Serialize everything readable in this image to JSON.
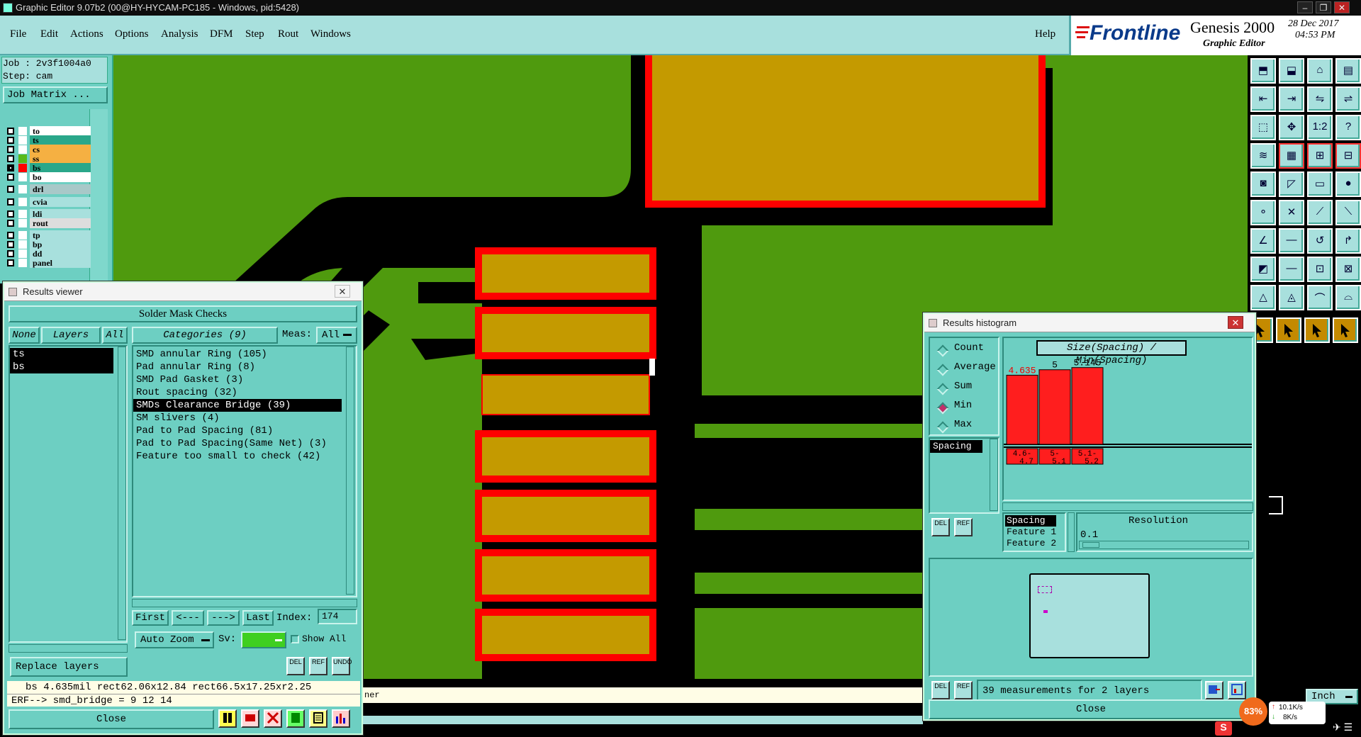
{
  "window": {
    "title": "Graphic Editor 9.07b2 (00@HY-HYCAM-PC185 - Windows, pid:5428)"
  },
  "menu": [
    "File",
    "Edit",
    "Actions",
    "Options",
    "Analysis",
    "DFM",
    "Step",
    "Rout",
    "Windows"
  ],
  "help_label": "Help",
  "brand": {
    "logo": "Frontline",
    "product": "Genesis 2000",
    "subtitle": "Graphic Editor",
    "date": "28 Dec 2017",
    "time": "04:53 PM"
  },
  "job": {
    "job_line": "Job : 2v3f1004a0",
    "step_line": "Step: cam",
    "matrix_button": "Job Matrix ..."
  },
  "layers": [
    {
      "name": "to",
      "color": "#ffffff",
      "swatch": "#ffffff",
      "checked": false
    },
    {
      "name": "ts",
      "color": "#2aa78a",
      "swatch": "#ffffff",
      "checked": false
    },
    {
      "name": "cs",
      "color": "#f5b042",
      "swatch": "#ffffff",
      "checked": false
    },
    {
      "name": "ss",
      "color": "#f5b042",
      "swatch": "#58b91a",
      "checked": false
    },
    {
      "name": "bs",
      "color": "#2aa78a",
      "swatch": "#ff0000",
      "checked": true
    },
    {
      "name": "bo",
      "color": "#ffffff",
      "swatch": "#ffffff",
      "checked": false
    },
    {
      "name": "drl",
      "color": "#a8c8c8",
      "swatch": "#ffffff",
      "checked": false
    },
    {
      "name": "cvia",
      "color": "#a8e0dd",
      "swatch": "#ffffff",
      "checked": false
    },
    {
      "name": "ldi",
      "color": "#a8e0dd",
      "swatch": "#ffffff",
      "checked": false
    },
    {
      "name": "rout",
      "color": "#dddddd",
      "swatch": "#ffffff",
      "checked": false
    },
    {
      "name": "tp",
      "color": "#a8e0dd",
      "swatch": "#ffffff",
      "checked": false
    },
    {
      "name": "bp",
      "color": "#a8e0dd",
      "swatch": "#ffffff",
      "checked": false
    },
    {
      "name": "dd",
      "color": "#a8e0dd",
      "swatch": "#ffffff",
      "checked": false
    },
    {
      "name": "panel",
      "color": "#a8e0dd",
      "swatch": "#ffffff",
      "checked": false
    }
  ],
  "results_viewer": {
    "title": "Results viewer",
    "header": "Solder Mask Checks",
    "none_btn": "None",
    "layers_btn": "Layers",
    "all_btn": "All",
    "layer_items": [
      "ts",
      "bs"
    ],
    "categories_label": "Categories (9)",
    "meas_label": "Meas:",
    "meas_value": "All",
    "categories": [
      "SMD annular Ring (105)",
      "Pad annular Ring (8)",
      "SMD Pad Gasket (3)",
      "Rout spacing (32)",
      "SMDs Clearance Bridge (39)",
      "SM slivers (4)",
      "Pad to Pad Spacing (81)",
      "Pad to Pad Spacing(Same Net) (3)",
      "Feature too small to check (42)"
    ],
    "selected_category": 4,
    "first_btn": "First",
    "prev_btn": "<---",
    "next_btn": "--->",
    "last_btn": "Last",
    "index_label": "Index:",
    "index_value": "174",
    "auto_zoom": "Auto Zoom",
    "sv_label": "Sv:",
    "show_all": "Show All",
    "replace_layers": "Replace layers",
    "status_line": "bs 4.635mil  rect62.06x12.84  rect66.5x17.25xr2.25",
    "erf_line": "ERF--> smd_bridge = 9 12 14",
    "close": "Close",
    "del": "DEL",
    "ref": "REF",
    "undo": "UNDO"
  },
  "histogram": {
    "title": "Results histogram",
    "chart_title": "Size(Spacing) / Min(Spacing)",
    "radios": [
      "Count",
      "Average",
      "Sum",
      "Min",
      "Max"
    ],
    "selected_radio": 3,
    "list_item": "Spacing",
    "attrs": [
      "Spacing",
      "Feature 1",
      "Feature 2"
    ],
    "resolution_label": "Resolution",
    "resolution_value": "0.1",
    "summary": "39 measurements for 2 layers",
    "close": "Close",
    "del": "DEL",
    "ref": "REF"
  },
  "chart_data": {
    "type": "bar",
    "title": "Size(Spacing) / Min(Spacing)",
    "categories": [
      "4.6-4.7",
      "5-5.1",
      "5.1-5.2"
    ],
    "values": [
      4.635,
      5,
      5.145
    ],
    "value_labels": [
      "4.635",
      "5",
      "5.145"
    ],
    "bar_color": "#ff1e1e",
    "ylim": [
      0,
      5.4
    ]
  },
  "canvas_partial_text": "ner",
  "units_label": "Inch",
  "tray": {
    "cpu": "83%",
    "up": "10.1K/s",
    "down": "8K/s"
  },
  "colors": {
    "board": "#4f9a0e",
    "pad": "#c49a00",
    "clearance": "#ff0000",
    "panel": "#6dcfc2",
    "menubar": "#a8e0dd"
  }
}
